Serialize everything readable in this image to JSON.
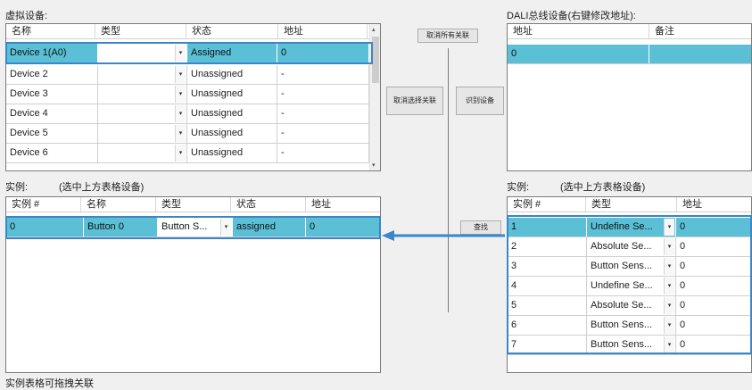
{
  "virtual": {
    "label": "虚拟设备:",
    "headers": [
      "名称",
      "类型",
      "状态",
      "地址"
    ],
    "rows": [
      {
        "name": "Device 1(A0)",
        "type": "",
        "status": "Assigned",
        "addr": "0"
      },
      {
        "name": "Device 2",
        "type": "",
        "status": "Unassigned",
        "addr": "-"
      },
      {
        "name": "Device 3",
        "type": "",
        "status": "Unassigned",
        "addr": "-"
      },
      {
        "name": "Device 4",
        "type": "",
        "status": "Unassigned",
        "addr": "-"
      },
      {
        "name": "Device 5",
        "type": "",
        "status": "Unassigned",
        "addr": "-"
      },
      {
        "name": "Device 6",
        "type": "",
        "status": "Unassigned",
        "addr": "-"
      }
    ]
  },
  "instances": {
    "label": "实例:",
    "hint": "(选中上方表格设备)",
    "headers": [
      "实例 #",
      "名称",
      "类型",
      "状态",
      "地址"
    ],
    "rows": [
      {
        "id": "0",
        "name": "Button 0",
        "type": "Button S...",
        "status": "assigned",
        "addr": "0"
      }
    ]
  },
  "buttons": {
    "cancel_all": "取消所有关联",
    "cancel_selected": "取消选择关联",
    "identify": "识别设备",
    "find": "查找"
  },
  "dali": {
    "label": "DALI总线设备(右键修改地址):",
    "headers": [
      "地址",
      "备注"
    ],
    "rows": [
      {
        "addr": "0",
        "note": ""
      }
    ]
  },
  "dali_instances": {
    "label": "实例:",
    "hint": "(选中上方表格设备)",
    "headers": [
      "实例 #",
      "类型",
      "地址"
    ],
    "rows": [
      {
        "id": "1",
        "type": "Undefine Se...",
        "addr": "0"
      },
      {
        "id": "2",
        "type": "Absolute Se...",
        "addr": "0"
      },
      {
        "id": "3",
        "type": "Button Sens...",
        "addr": "0"
      },
      {
        "id": "4",
        "type": "Undefine Se...",
        "addr": "0"
      },
      {
        "id": "5",
        "type": "Absolute Se...",
        "addr": "0"
      },
      {
        "id": "6",
        "type": "Button Sens...",
        "addr": "0"
      },
      {
        "id": "7",
        "type": "Button Sens...",
        "addr": "0"
      }
    ]
  },
  "footer": "实例表格可拖拽关联",
  "colors": {
    "selection": "#5bc0d6",
    "outline": "#3a86c8",
    "arrow": "#3a86c8"
  }
}
